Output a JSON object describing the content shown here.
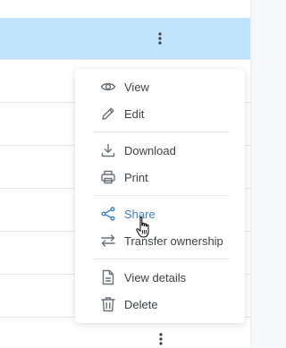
{
  "menu": {
    "groups": [
      [
        {
          "icon": "eye-icon",
          "label": "View"
        },
        {
          "icon": "pencil-icon",
          "label": "Edit"
        }
      ],
      [
        {
          "icon": "download-icon",
          "label": "Download"
        },
        {
          "icon": "printer-icon",
          "label": "Print"
        }
      ],
      [
        {
          "icon": "share-icon",
          "label": "Share",
          "state": "hover"
        },
        {
          "icon": "transfer-arrows-icon",
          "label": "Transfer ownership"
        }
      ],
      [
        {
          "icon": "document-icon",
          "label": "View details"
        },
        {
          "icon": "trash-icon",
          "label": "Delete"
        }
      ]
    ]
  },
  "colors": {
    "selected_row": "#bfe3fb",
    "accent": "#3d7fd6",
    "text": "#3d4247",
    "icon": "#6b7177"
  }
}
